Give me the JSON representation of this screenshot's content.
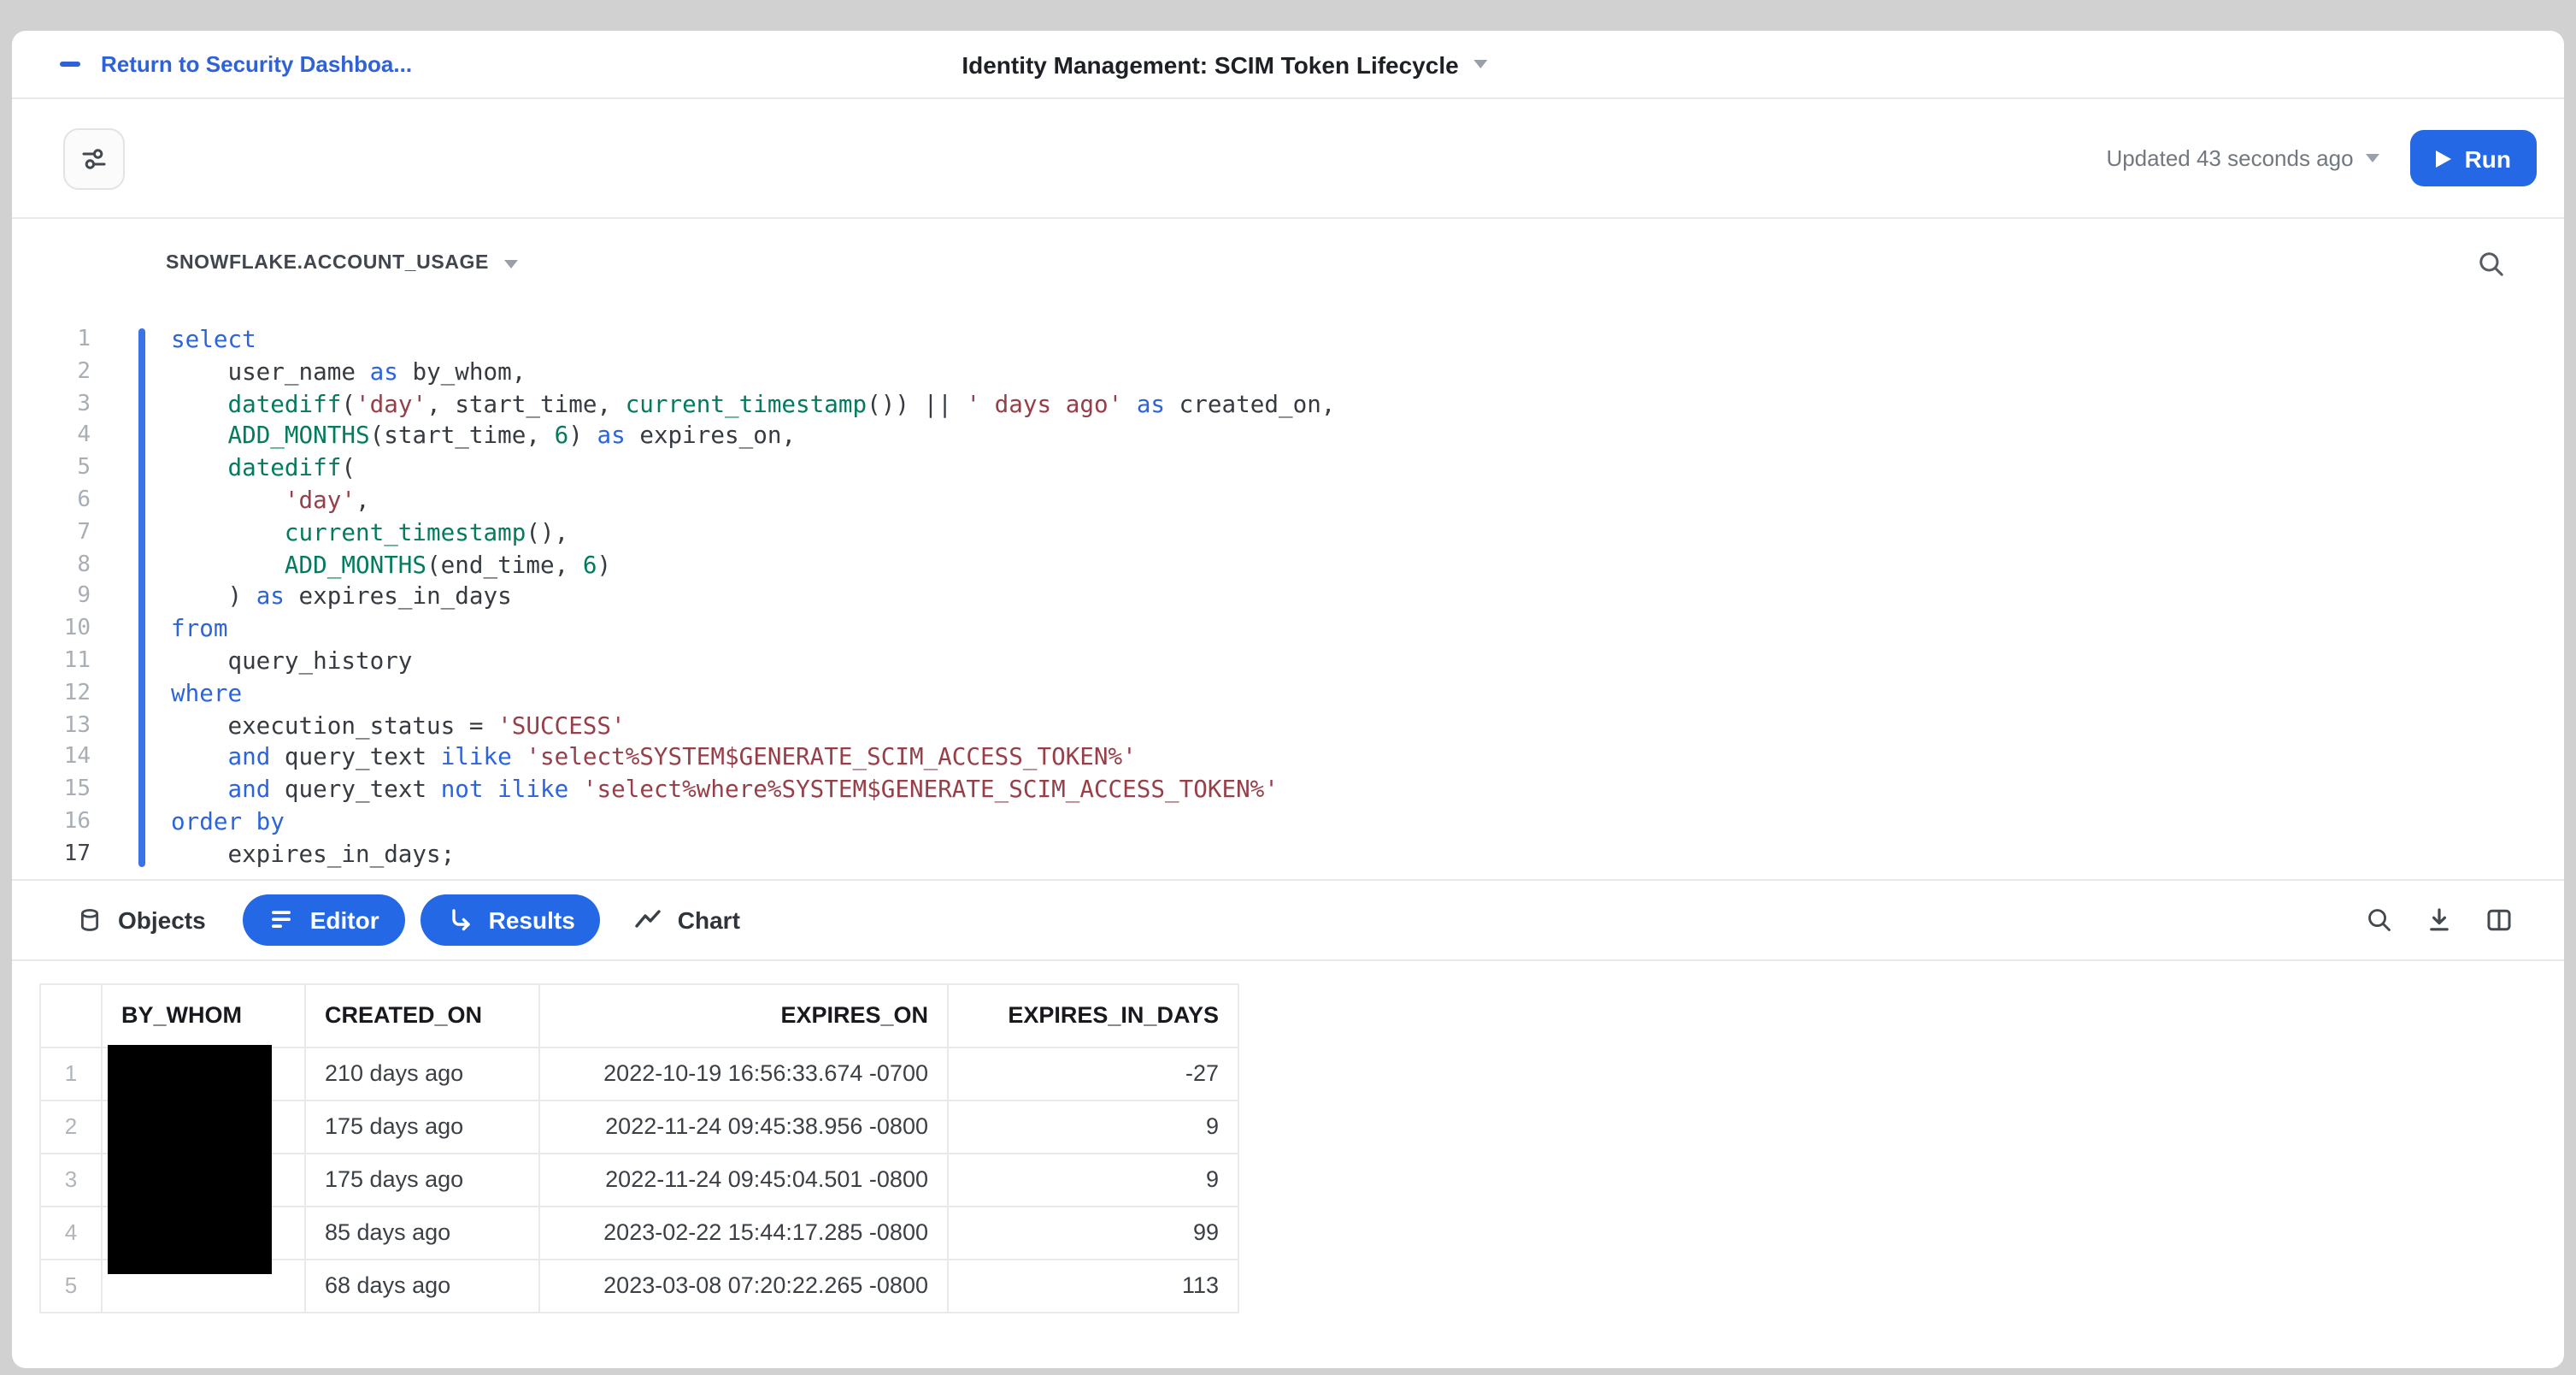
{
  "header": {
    "back_link": "Return to Security Dashboa...",
    "title": "Identity Management: SCIM Token Lifecycle"
  },
  "toolbar": {
    "updated": "Updated 43 seconds ago",
    "run": "Run"
  },
  "editor": {
    "context": "SNOWFLAKE.ACCOUNT_USAGE",
    "active_line": 17,
    "lines": [
      [
        [
          "k",
          "select"
        ]
      ],
      [
        [
          "t",
          "    user_name "
        ],
        [
          "k",
          "as"
        ],
        [
          "t",
          " by_whom,"
        ]
      ],
      [
        [
          "t",
          "    "
        ],
        [
          "f",
          "datediff"
        ],
        [
          "t",
          "("
        ],
        [
          "s",
          "'day'"
        ],
        [
          "t",
          ", start_time, "
        ],
        [
          "f",
          "current_timestamp"
        ],
        [
          "t",
          "()) || "
        ],
        [
          "s",
          "' days ago'"
        ],
        [
          "t",
          " "
        ],
        [
          "k",
          "as"
        ],
        [
          "t",
          " created_on,"
        ]
      ],
      [
        [
          "t",
          "    "
        ],
        [
          "f",
          "ADD_MONTHS"
        ],
        [
          "t",
          "(start_time, "
        ],
        [
          "n",
          "6"
        ],
        [
          "t",
          ") "
        ],
        [
          "k",
          "as"
        ],
        [
          "t",
          " expires_on,"
        ]
      ],
      [
        [
          "t",
          "    "
        ],
        [
          "f",
          "datediff"
        ],
        [
          "t",
          "("
        ]
      ],
      [
        [
          "t",
          "        "
        ],
        [
          "s",
          "'day'"
        ],
        [
          "t",
          ","
        ]
      ],
      [
        [
          "t",
          "        "
        ],
        [
          "f",
          "current_timestamp"
        ],
        [
          "t",
          "(),"
        ]
      ],
      [
        [
          "t",
          "        "
        ],
        [
          "f",
          "ADD_MONTHS"
        ],
        [
          "t",
          "(end_time, "
        ],
        [
          "n",
          "6"
        ],
        [
          "t",
          ")"
        ]
      ],
      [
        [
          "t",
          "    ) "
        ],
        [
          "k",
          "as"
        ],
        [
          "t",
          " expires_in_days"
        ]
      ],
      [
        [
          "k",
          "from"
        ]
      ],
      [
        [
          "t",
          "    query_history"
        ]
      ],
      [
        [
          "k",
          "where"
        ]
      ],
      [
        [
          "t",
          "    execution_status = "
        ],
        [
          "s",
          "'SUCCESS'"
        ]
      ],
      [
        [
          "t",
          "    "
        ],
        [
          "k",
          "and"
        ],
        [
          "t",
          " query_text "
        ],
        [
          "k",
          "ilike"
        ],
        [
          "t",
          " "
        ],
        [
          "s",
          "'select%SYSTEM$GENERATE_SCIM_ACCESS_TOKEN%'"
        ]
      ],
      [
        [
          "t",
          "    "
        ],
        [
          "k",
          "and"
        ],
        [
          "t",
          " query_text "
        ],
        [
          "k",
          "not"
        ],
        [
          "t",
          " "
        ],
        [
          "k",
          "ilike"
        ],
        [
          "t",
          " "
        ],
        [
          "s",
          "'select%where%SYSTEM$GENERATE_SCIM_ACCESS_TOKEN%'"
        ]
      ],
      [
        [
          "k",
          "order by"
        ]
      ],
      [
        [
          "t",
          "    expires_in_days;"
        ]
      ]
    ]
  },
  "tabs": {
    "objects": "Objects",
    "editor": "Editor",
    "results": "Results",
    "chart": "Chart"
  },
  "results_table": {
    "columns": [
      "",
      "BY_WHOM",
      "CREATED_ON",
      "EXPIRES_ON",
      "EXPIRES_IN_DAYS"
    ],
    "by_whom_redacted": true,
    "rows": [
      {
        "n": "1",
        "by_whom": "",
        "created_on": "210 days ago",
        "expires_on": "2022-10-19 16:56:33.674 -0700",
        "expires_in_days": "-27"
      },
      {
        "n": "2",
        "by_whom": "",
        "created_on": "175 days ago",
        "expires_on": "2022-11-24 09:45:38.956 -0800",
        "expires_in_days": "9"
      },
      {
        "n": "3",
        "by_whom": "",
        "created_on": "175 days ago",
        "expires_on": "2022-11-24 09:45:04.501 -0800",
        "expires_in_days": "9"
      },
      {
        "n": "4",
        "by_whom": "",
        "created_on": "85 days ago",
        "expires_on": "2023-02-22 15:44:17.285 -0800",
        "expires_in_days": "99"
      },
      {
        "n": "5",
        "by_whom": "",
        "created_on": "68 days ago",
        "expires_on": "2023-03-08 07:20:22.265 -0800",
        "expires_in_days": "113"
      }
    ]
  },
  "colors": {
    "accent_blue": "#2468e5",
    "link_blue": "#2e62d9",
    "keyword_blue": "#2c64dc",
    "function_green": "#047a5e",
    "string_red": "#963f49",
    "statement_bar": "#3b72e8"
  }
}
